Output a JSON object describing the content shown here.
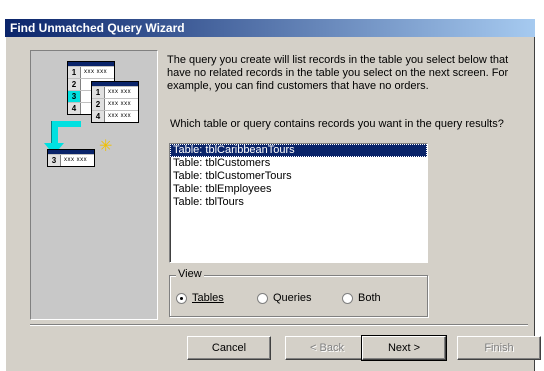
{
  "window": {
    "title": "Find Unmatched Query Wizard"
  },
  "description": "The query you create will list records in the table you select below that have no related records in the table you select on the next screen. For example, you can find customers that have no orders.",
  "question": "Which table or query contains records you want in the query results?",
  "tables": [
    {
      "label": "Table: tblCaribbeanTours",
      "selected": true
    },
    {
      "label": "Table: tblCustomers",
      "selected": false
    },
    {
      "label": "Table: tblCustomerTours",
      "selected": false
    },
    {
      "label": "Table: tblEmployees",
      "selected": false
    },
    {
      "label": "Table: tblTours",
      "selected": false
    }
  ],
  "view": {
    "label": "View",
    "options": [
      {
        "label": "Tables",
        "checked": true
      },
      {
        "label": "Queries",
        "checked": false
      },
      {
        "label": "Both",
        "checked": false
      }
    ]
  },
  "buttons": {
    "cancel": "Cancel",
    "back": "< Back",
    "next": "Next >",
    "finish": "Finish"
  },
  "illustration": {
    "rows_left": [
      "1",
      "2",
      "3",
      "4"
    ],
    "rows_right": [
      "1",
      "2",
      "4"
    ],
    "row_result": "3",
    "placeholder": "xxx xxx"
  },
  "colors": {
    "title_bar": "#0a246a",
    "dialog_bg": "#d4d0c8",
    "selection": "#0a246a",
    "arrow": "#00e0e0"
  }
}
